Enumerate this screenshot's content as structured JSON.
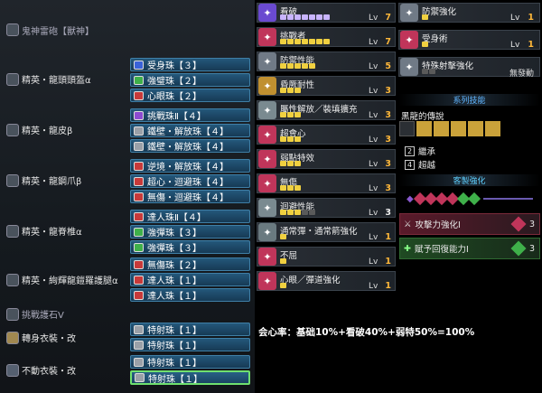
{
  "weapon": {
    "name": "鬼神雷砲【獸神】"
  },
  "equipment": [
    {
      "name": "精英・龍頭頭盔α",
      "decos": [
        {
          "label": "受身珠【３】",
          "color": "#3a62d8"
        },
        {
          "label": "強璧珠【２】",
          "color": "#3fb04a"
        },
        {
          "label": "心眼珠【２】",
          "color": "#c83a3a"
        }
      ]
    },
    {
      "name": "精英・龍皮β",
      "decos": [
        {
          "label": "挑戰珠Ⅱ【４】",
          "color": "#8e4bd0"
        },
        {
          "label": "鐵壁・解放珠【４】",
          "color": "#9aa0a8"
        },
        {
          "label": "鐵壁・解放珠【４】",
          "color": "#9aa0a8"
        }
      ]
    },
    {
      "name": "精英・龍鋼爪β",
      "decos": [
        {
          "label": "逆境・解放珠【４】",
          "color": "#c83a3a"
        },
        {
          "label": "超心・迴避珠【４】",
          "color": "#c83a3a"
        },
        {
          "label": "無傷・迴避珠【４】",
          "color": "#c83a3a"
        }
      ]
    },
    {
      "name": "精英・龍脊椎α",
      "decos": [
        {
          "label": "達人珠Ⅱ【４】",
          "color": "#c83a3a"
        },
        {
          "label": "強彈珠【３】",
          "color": "#3fb04a"
        },
        {
          "label": "強彈珠【３】",
          "color": "#3fb04a"
        }
      ]
    },
    {
      "name": "精英・絢輝龍鎧羅護腿α",
      "decos": [
        {
          "label": "無傷珠【２】",
          "color": "#c83a3a"
        },
        {
          "label": "達人珠【１】",
          "color": "#c83a3a"
        },
        {
          "label": "達人珠【１】",
          "color": "#c83a3a"
        }
      ]
    },
    {
      "name": "挑戰護石Ⅴ",
      "decos": []
    },
    {
      "name": "轉身衣裝・改",
      "decos": [
        {
          "label": "特射珠【１】",
          "color": "#9aa0a8"
        },
        {
          "label": "特射珠【１】",
          "color": "#9aa0a8"
        }
      ]
    },
    {
      "name": "不動衣裝・改",
      "decos": [
        {
          "label": "特射珠【１】",
          "color": "#9aa0a8"
        },
        {
          "label": "特射珠【１】",
          "color": "#9aa0a8"
        }
      ]
    }
  ],
  "skills_mid": [
    {
      "name": "看破",
      "lv_label": "Lv",
      "level": "7",
      "max": 7,
      "color": "#6a4ad0"
    },
    {
      "name": "挑戰者",
      "lv_label": "Lv",
      "level": "7",
      "max": 7,
      "color": "#c0355a"
    },
    {
      "name": "防禦性能",
      "lv_label": "Lv",
      "level": "5",
      "max": 5,
      "color": "#707a86"
    },
    {
      "name": "昏厥耐性",
      "lv_label": "Lv",
      "level": "3",
      "max": 3,
      "color": "#c09030"
    },
    {
      "name": "屬性解放／裝填擴充",
      "lv_label": "Lv",
      "level": "3",
      "max": 3,
      "color": "#7a8a90"
    },
    {
      "name": "超會心",
      "lv_label": "Lv",
      "level": "3",
      "max": 3,
      "color": "#c0355a"
    },
    {
      "name": "弱點特效",
      "lv_label": "Lv",
      "level": "3",
      "max": 3,
      "color": "#c0355a"
    },
    {
      "name": "無傷",
      "lv_label": "Lv",
      "level": "3",
      "max": 3,
      "color": "#c0355a"
    },
    {
      "name": "迴避性能",
      "lv_label": "Lv",
      "level": "3",
      "max": 5,
      "color": "#7a8a90"
    },
    {
      "name": "通常彈・通常箭強化",
      "lv_label": "Lv",
      "level": "1",
      "max": 1,
      "color": "#6a7a80"
    },
    {
      "name": "不屈",
      "lv_label": "Lv",
      "level": "1",
      "max": 1,
      "color": "#c0355a"
    },
    {
      "name": "心眼／彈道強化",
      "lv_label": "Lv",
      "level": "1",
      "max": 1,
      "color": "#c0355a"
    }
  ],
  "skills_right": [
    {
      "name": "防禦強化",
      "lv_label": "Lv",
      "level": "1",
      "max": 1,
      "color": "#707a86"
    },
    {
      "name": "受身術",
      "lv_label": "Lv",
      "level": "1",
      "max": 1,
      "color": "#c0355a"
    },
    {
      "name": "特殊射擊強化",
      "lv_label": "",
      "level": "無發動",
      "max": 2,
      "color": "#707a86"
    }
  ],
  "series": {
    "header": "系列技能",
    "name": "黑龍的傳說",
    "items": [
      {
        "num": "2",
        "label": "繼承"
      },
      {
        "num": "4",
        "label": "超越"
      }
    ]
  },
  "custom": {
    "header": "客製強化",
    "items": [
      {
        "label": "攻擊力強化Ⅰ",
        "count": "3",
        "color": "#c0355a"
      },
      {
        "label": "賦予回復能力Ⅰ",
        "count": "3",
        "color": "#3fb04a"
      }
    ]
  },
  "formula": "会心率：基础10%+看破40%+弱特50%=100%"
}
